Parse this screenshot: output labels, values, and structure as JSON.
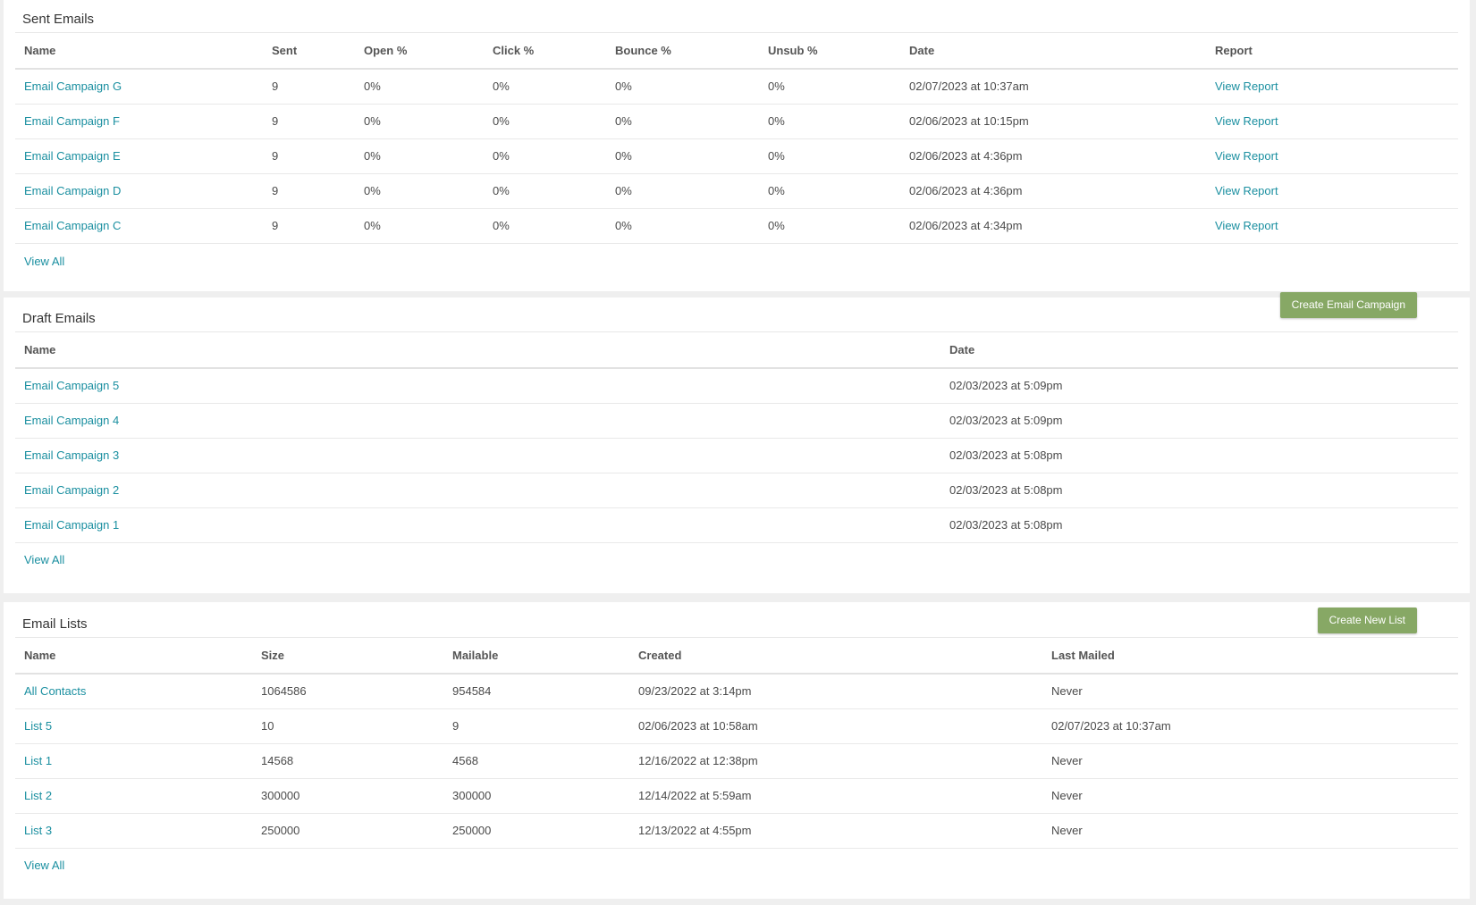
{
  "sent": {
    "title": "Sent Emails",
    "columns": [
      "Name",
      "Sent",
      "Open %",
      "Click %",
      "Bounce %",
      "Unsub %",
      "Date",
      "Report"
    ],
    "rows": [
      {
        "name": "Email Campaign G",
        "sent": "9",
        "open": "0%",
        "click": "0%",
        "bounce": "0%",
        "unsub": "0%",
        "date": "02/07/2023 at 10:37am",
        "report": "View Report"
      },
      {
        "name": "Email Campaign F",
        "sent": "9",
        "open": "0%",
        "click": "0%",
        "bounce": "0%",
        "unsub": "0%",
        "date": "02/06/2023 at 10:15pm",
        "report": "View Report"
      },
      {
        "name": "Email Campaign E",
        "sent": "9",
        "open": "0%",
        "click": "0%",
        "bounce": "0%",
        "unsub": "0%",
        "date": "02/06/2023 at 4:36pm",
        "report": "View Report"
      },
      {
        "name": "Email Campaign D",
        "sent": "9",
        "open": "0%",
        "click": "0%",
        "bounce": "0%",
        "unsub": "0%",
        "date": "02/06/2023 at 4:36pm",
        "report": "View Report"
      },
      {
        "name": "Email Campaign C",
        "sent": "9",
        "open": "0%",
        "click": "0%",
        "bounce": "0%",
        "unsub": "0%",
        "date": "02/06/2023 at 4:34pm",
        "report": "View Report"
      }
    ],
    "view_all": "View All"
  },
  "draft": {
    "title": "Draft Emails",
    "create_button": "Create Email Campaign",
    "columns": [
      "Name",
      "Date"
    ],
    "rows": [
      {
        "name": "Email Campaign 5",
        "date": "02/03/2023 at 5:09pm"
      },
      {
        "name": "Email Campaign 4",
        "date": "02/03/2023 at 5:09pm"
      },
      {
        "name": "Email Campaign 3",
        "date": "02/03/2023 at 5:08pm"
      },
      {
        "name": "Email Campaign 2",
        "date": "02/03/2023 at 5:08pm"
      },
      {
        "name": "Email Campaign 1",
        "date": "02/03/2023 at 5:08pm"
      }
    ],
    "view_all": "View All"
  },
  "lists": {
    "title": "Email Lists",
    "create_button": "Create New List",
    "columns": [
      "Name",
      "Size",
      "Mailable",
      "Created",
      "Last Mailed"
    ],
    "rows": [
      {
        "name": "All Contacts",
        "size": "1064586",
        "mailable": "954584",
        "created": "09/23/2022 at 3:14pm",
        "last_mailed": "Never"
      },
      {
        "name": "List 5",
        "size": "10",
        "mailable": "9",
        "created": "02/06/2023 at 10:58am",
        "last_mailed": "02/07/2023 at 10:37am"
      },
      {
        "name": "List 1",
        "size": "14568",
        "mailable": "4568",
        "created": "12/16/2022 at 12:38pm",
        "last_mailed": "Never"
      },
      {
        "name": "List 2",
        "size": "300000",
        "mailable": "300000",
        "created": "12/14/2022 at 5:59am",
        "last_mailed": "Never"
      },
      {
        "name": "List 3",
        "size": "250000",
        "mailable": "250000",
        "created": "12/13/2022 at 4:55pm",
        "last_mailed": "Never"
      }
    ],
    "view_all": "View All"
  },
  "colors": {
    "link": "#1a8fa0",
    "button": "#87a865",
    "background": "#efefef"
  }
}
